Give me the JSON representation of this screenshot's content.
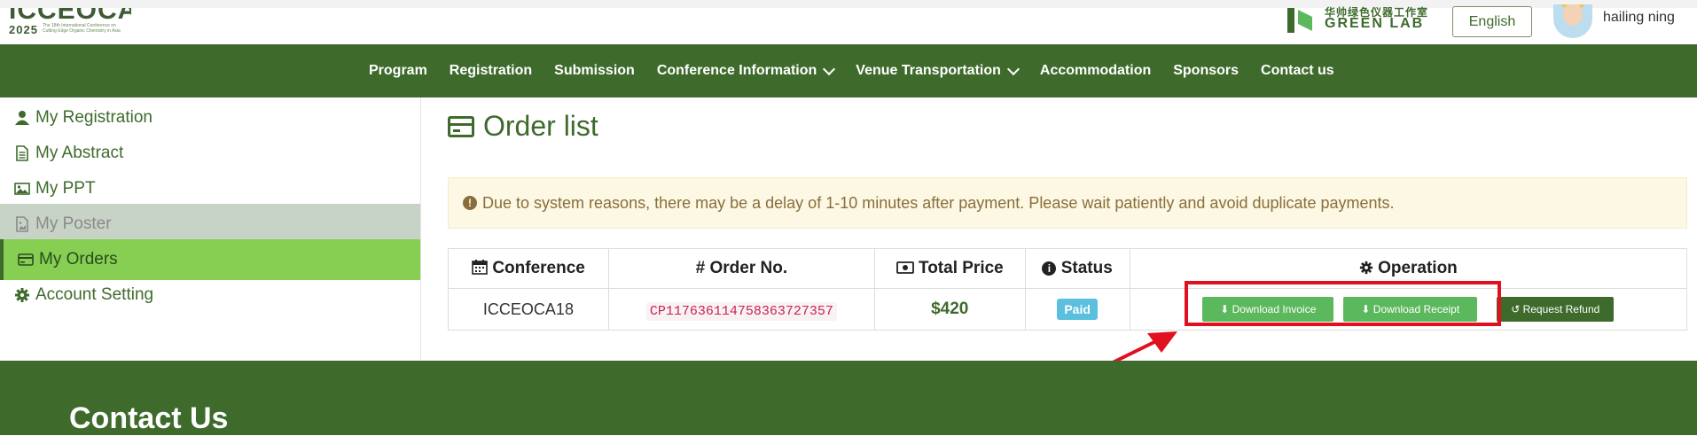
{
  "header": {
    "logo_text": "ICCEOCA",
    "logo_year": "2025",
    "logo_subtitle": "The 18th International Conference on Cutting Edge Organic Chemistry in Asia",
    "partner_cn": "华帅绿色仪器工作室",
    "partner_en": "GREEN LAB",
    "language_button": "English",
    "username": "hailing ning"
  },
  "nav": {
    "items": [
      {
        "label": "Program",
        "dropdown": false
      },
      {
        "label": "Registration",
        "dropdown": false
      },
      {
        "label": "Submission",
        "dropdown": false
      },
      {
        "label": "Conference Information",
        "dropdown": true
      },
      {
        "label": "Venue Transportation",
        "dropdown": true
      },
      {
        "label": "Accommodation",
        "dropdown": false
      },
      {
        "label": "Sponsors",
        "dropdown": false
      },
      {
        "label": "Contact us",
        "dropdown": false
      }
    ]
  },
  "sidebar": {
    "items": [
      {
        "label": "My Registration",
        "icon": "user-icon",
        "state": "normal"
      },
      {
        "label": "My Abstract",
        "icon": "file-text-icon",
        "state": "normal"
      },
      {
        "label": "My PPT",
        "icon": "image-icon",
        "state": "normal"
      },
      {
        "label": "My Poster",
        "icon": "file-image-icon",
        "state": "disabled"
      },
      {
        "label": "My Orders",
        "icon": "credit-card-icon",
        "state": "active"
      },
      {
        "label": "Account Setting",
        "icon": "gear-icon",
        "state": "normal"
      }
    ]
  },
  "main": {
    "title": "Order list",
    "alert": "Due to system reasons, there may be a delay of 1-10 minutes after payment. Please wait patiently and avoid duplicate payments.",
    "table": {
      "headers": [
        "Conference",
        "Order No.",
        "Total Price",
        "Status",
        "Operation"
      ],
      "rows": [
        {
          "conference": "ICCEOCA18",
          "order_no": "CP117636114758363727357",
          "total_price": "$420",
          "status": "Paid",
          "actions": [
            "Download Invoice",
            "Download Receipt",
            "Request Refund"
          ]
        }
      ]
    }
  },
  "footer": {
    "title": "Contact Us"
  },
  "colors": {
    "brand_green": "#3e6b2c",
    "active_green": "#86cf52",
    "button_green": "#5cb85c",
    "highlight_red": "#e0101e",
    "alert_bg": "#fcf8e3",
    "paid_badge": "#5bc0de"
  }
}
